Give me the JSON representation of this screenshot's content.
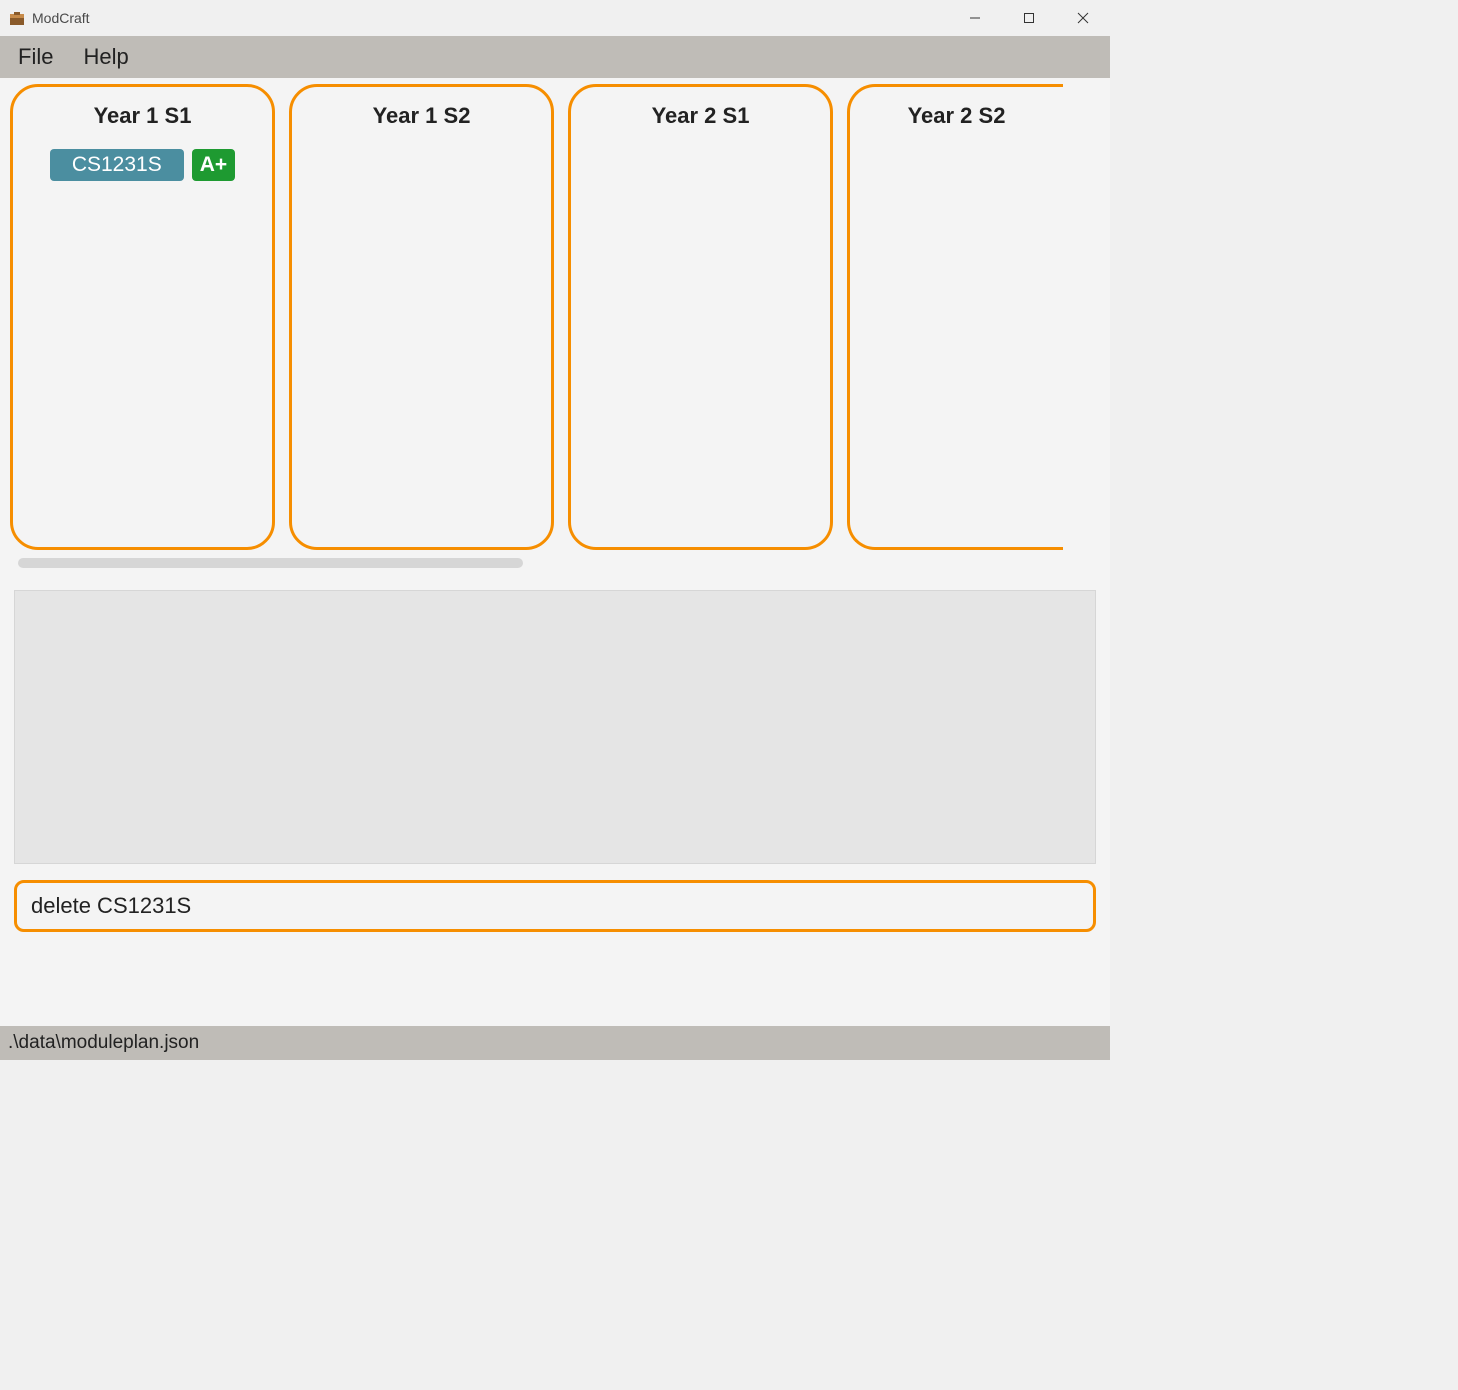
{
  "window": {
    "title": "ModCraft"
  },
  "menubar": {
    "file": "File",
    "help": "Help"
  },
  "semesters": [
    {
      "title": "Year 1 S1",
      "modules": [
        {
          "code": "CS1231S",
          "grade": "A+"
        }
      ]
    },
    {
      "title": "Year 1 S2",
      "modules": []
    },
    {
      "title": "Year 2 S1",
      "modules": []
    },
    {
      "title": "Year 2 S2",
      "modules": []
    }
  ],
  "command_input": {
    "value": "delete CS1231S"
  },
  "statusbar": {
    "path": ".\\data\\moduleplan.json"
  },
  "colors": {
    "accent": "#f68e00",
    "module_chip": "#4b8ea0",
    "grade_chip": "#1e9a31"
  }
}
